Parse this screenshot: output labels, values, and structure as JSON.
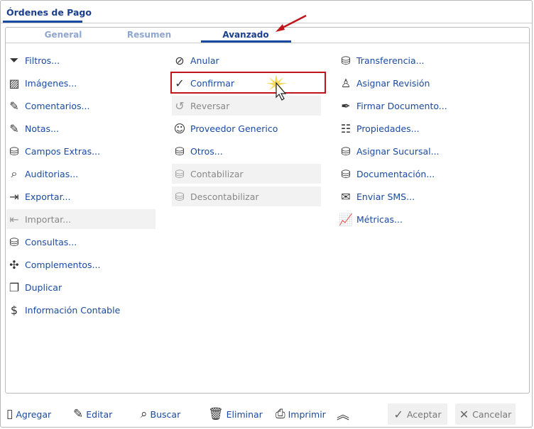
{
  "window": {
    "title": "Órdenes de Pago"
  },
  "tabs": [
    {
      "label": "General"
    },
    {
      "label": "Resumen"
    },
    {
      "label": "Avanzado",
      "active": true
    }
  ],
  "columns": [
    [
      {
        "label": "Filtros...",
        "icon": "filter-icon"
      },
      {
        "label": "Imágenes...",
        "icon": "image-icon"
      },
      {
        "label": "Comentarios...",
        "icon": "clipboard-edit-icon"
      },
      {
        "label": "Notas...",
        "icon": "clipboard-edit-icon"
      },
      {
        "label": "Campos Extras...",
        "icon": "database-icon"
      },
      {
        "label": "Auditorias...",
        "icon": "audit-icon"
      },
      {
        "label": "Exportar...",
        "icon": "database-export-icon"
      },
      {
        "label": "Importar...",
        "icon": "database-import-icon",
        "disabled": true
      },
      {
        "label": "Consultas...",
        "icon": "database-icon"
      },
      {
        "label": "Complementos...",
        "icon": "puzzle-icon"
      },
      {
        "label": "Duplicar",
        "icon": "copy-icon"
      },
      {
        "label": "Información Contable",
        "icon": "dollar-icon"
      }
    ],
    [
      {
        "label": "Anular",
        "icon": "document-cancel-icon"
      },
      {
        "label": "Confirmar",
        "icon": "document-check-icon"
      },
      {
        "label": "Reversar",
        "icon": "document-undo-icon",
        "disabled": true
      },
      {
        "label": "Proveedor Generico",
        "icon": "user-circle-icon"
      },
      {
        "label": "Otros...",
        "icon": "database-icon"
      },
      {
        "label": "Contabilizar",
        "icon": "database-icon",
        "disabled": true
      },
      {
        "label": "Descontabilizar",
        "icon": "database-icon",
        "disabled": true
      }
    ],
    [
      {
        "label": "Transferencia...",
        "icon": "database-icon"
      },
      {
        "label": "Asignar Revisión",
        "icon": "stamp-icon"
      },
      {
        "label": "Firmar Documento...",
        "icon": "pen-icon"
      },
      {
        "label": "Propiedades...",
        "icon": "properties-icon"
      },
      {
        "label": "Asignar Sucursal...",
        "icon": "database-icon"
      },
      {
        "label": "Documentación...",
        "icon": "database-icon"
      },
      {
        "label": "Enviar SMS...",
        "icon": "sms-icon"
      },
      {
        "label": "Métricas...",
        "icon": "chart-icon"
      }
    ]
  ],
  "footer": {
    "add": "Agregar",
    "edit": "Editar",
    "search": "Buscar",
    "delete": "Eliminar",
    "print": "Imprimir",
    "accept": "Aceptar",
    "cancel": "Cancelar"
  }
}
